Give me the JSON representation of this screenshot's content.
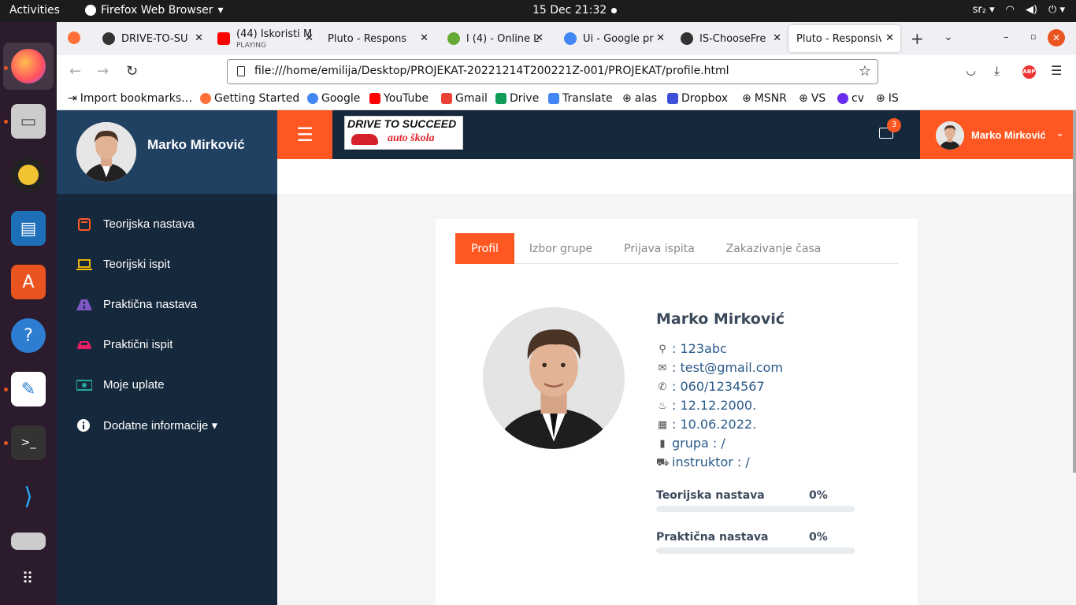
{
  "os": {
    "activities": "Activities",
    "app_name": "Firefox Web Browser",
    "clock": "15 Dec  21:32",
    "keyboard": "sr₂"
  },
  "tabs": [
    {
      "label": "DRIVE-TO-SU",
      "active": false
    },
    {
      "label": "(44) Iskoristi M",
      "sub": "PLAYING",
      "active": false
    },
    {
      "label": "Pluto - Responsiv",
      "active": false
    },
    {
      "label": "l (4) - Online L",
      "active": false
    },
    {
      "label": "Ui - Google pr",
      "active": false
    },
    {
      "label": "IS-ChooseFre",
      "active": false
    },
    {
      "label": "Pluto - Responsiv",
      "active": true
    }
  ],
  "url": "file:///home/emilija/Desktop/PROJEKAT-20221214T200221Z-001/PROJEKAT/profile.html",
  "bookmarks": [
    {
      "label": "Import bookmarks…",
      "color": "#444"
    },
    {
      "label": "Getting Started",
      "color": "#ff7139"
    },
    {
      "label": "Google",
      "color": "#4285f4"
    },
    {
      "label": "YouTube",
      "color": "#ff0000"
    },
    {
      "label": "Gmail",
      "color": "#ea4335"
    },
    {
      "label": "Drive",
      "color": "#0f9d58"
    },
    {
      "label": "Translate",
      "color": "#4285f4"
    },
    {
      "label": "alas",
      "color": "#555"
    },
    {
      "label": "Dropbox",
      "color": "#3d4fd6"
    },
    {
      "label": "MSNR",
      "color": "#555"
    },
    {
      "label": "VS",
      "color": "#555"
    },
    {
      "label": "cv",
      "color": "#6a2cf0"
    },
    {
      "label": "IS",
      "color": "#555"
    }
  ],
  "sidebar": {
    "user_name": "Marko Mirković",
    "items": [
      {
        "label": "Teorijska nastava",
        "icon": "book-icon",
        "color": "#ff5722"
      },
      {
        "label": "Teorijski ispit",
        "icon": "laptop-icon",
        "color": "#ffc107"
      },
      {
        "label": "Praktična nastava",
        "icon": "road-icon",
        "color": "#7e57c2"
      },
      {
        "label": "Praktični ispit",
        "icon": "car-icon",
        "color": "#e91e63"
      },
      {
        "label": "Moje uplate",
        "icon": "money-icon",
        "color": "#26a69a"
      },
      {
        "label": "Dodatne informacije ▾",
        "icon": "info-icon",
        "color": "#ffffff"
      }
    ]
  },
  "header": {
    "logo_line1": "DRIVE TO SUCCEED",
    "logo_line2": "auto škola",
    "mail_count": "3",
    "user_name": "Marko Mirković"
  },
  "profile": {
    "tabs": [
      "Profil",
      "Izbor grupe",
      "Prijava ispita",
      "Zakazivanje časa"
    ],
    "name": "Marko Mirković",
    "fields": [
      {
        "icon": "key-icon",
        "text": ": 123abc"
      },
      {
        "icon": "envelope-icon",
        "text": ": test@gmail.com"
      },
      {
        "icon": "phone-icon",
        "text": ": 060/1234567"
      },
      {
        "icon": "birthday-cake-icon",
        "text": ": 12.12.2000."
      },
      {
        "icon": "calendar-icon",
        "text": ": 10.06.2022."
      },
      {
        "icon": "book-icon",
        "text": "grupa : /"
      },
      {
        "icon": "car-icon",
        "text": "instruktor : /"
      }
    ],
    "progress": [
      {
        "label": "Teorijska nastava",
        "percent_text": "0%",
        "value": 0
      },
      {
        "label": "Praktična nastava",
        "percent_text": "0%",
        "value": 0
      }
    ]
  },
  "colors": {
    "accent": "#ff5722",
    "sidebar": "#15283c",
    "sidebar_head": "#214162"
  }
}
